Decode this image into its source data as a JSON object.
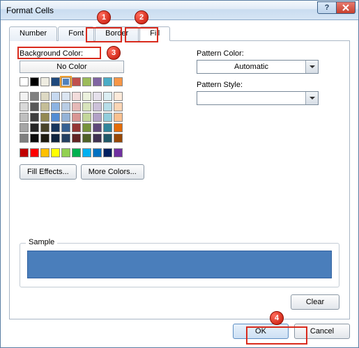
{
  "window": {
    "title": "Format Cells"
  },
  "tabs": {
    "number": "Number",
    "font": "Font",
    "border": "Border",
    "fill": "Fill"
  },
  "fill": {
    "bg_label": "Background Color:",
    "no_color": "No Color",
    "fill_effects": "Fill Effects...",
    "more_colors": "More Colors...",
    "pattern_color_label": "Pattern Color:",
    "pattern_color_value": "Automatic",
    "pattern_style_label": "Pattern Style:",
    "sample_label": "Sample",
    "selected_color": "#4a7ebb",
    "palette_top": [
      [
        "#ffffff",
        "#000000",
        "#eeece1",
        "#1f497d",
        "#4f81bd",
        "#c0504d",
        "#9bbb59",
        "#8064a2",
        "#4bacc6",
        "#f79646"
      ]
    ],
    "palette_theme": [
      [
        "#f2f2f2",
        "#7f7f7f",
        "#ddd9c3",
        "#c6d9f0",
        "#dbe5f1",
        "#f2dcdb",
        "#ebf1dd",
        "#e5e0ec",
        "#dbeef3",
        "#fdeada"
      ],
      [
        "#d8d8d8",
        "#595959",
        "#c4bd97",
        "#8db3e2",
        "#b8cce4",
        "#e5b9b7",
        "#d7e3bc",
        "#ccc1d9",
        "#b7dde8",
        "#fbd5b5"
      ],
      [
        "#bfbfbf",
        "#3f3f3f",
        "#938953",
        "#548dd4",
        "#95b3d7",
        "#d99694",
        "#c3d69b",
        "#b2a2c7",
        "#92cddc",
        "#fac08f"
      ],
      [
        "#a5a5a5",
        "#262626",
        "#494429",
        "#17365d",
        "#366092",
        "#953734",
        "#76923c",
        "#5f497a",
        "#31859b",
        "#e36c09"
      ],
      [
        "#7f7f7f",
        "#0c0c0c",
        "#1d1b10",
        "#0f243e",
        "#244061",
        "#632423",
        "#4f6128",
        "#3f3151",
        "#205867",
        "#974806"
      ]
    ],
    "palette_standard": [
      [
        "#c00000",
        "#ff0000",
        "#ffc000",
        "#ffff00",
        "#92d050",
        "#00b050",
        "#00b0f0",
        "#0070c0",
        "#002060",
        "#7030a0"
      ]
    ]
  },
  "buttons": {
    "clear": "Clear",
    "ok": "OK",
    "cancel": "Cancel"
  },
  "annotations": {
    "b1": "1",
    "b2": "2",
    "b3": "3",
    "b4": "4"
  }
}
